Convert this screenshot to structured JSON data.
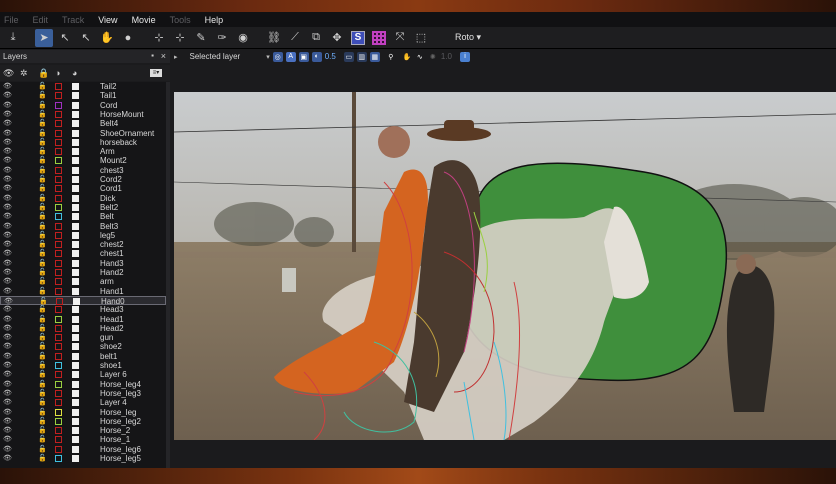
{
  "menu": [
    "File",
    "Edit",
    "Track",
    "View",
    "Movie",
    "Tools",
    "Help"
  ],
  "menu_dim": [
    true,
    true,
    true,
    false,
    false,
    true,
    false
  ],
  "toolbar": {
    "roto_label": "Roto",
    "s_label": "S"
  },
  "layers_panel": {
    "title": "Layers",
    "close": "×",
    "pin": "▪"
  },
  "viewer_toolbar": {
    "layer_select": "Selected layer",
    "opacity_value": "0.5",
    "disabled_value": "1.0"
  },
  "layers": [
    {
      "name": "Tail2",
      "color": "#c02020"
    },
    {
      "name": "Tail1",
      "color": "#c02020"
    },
    {
      "name": "Cord",
      "color": "#a030c0"
    },
    {
      "name": "HorseMount",
      "color": "#c02020"
    },
    {
      "name": "Belt4",
      "color": "#c02020"
    },
    {
      "name": "ShoeOrnament",
      "color": "#c02020"
    },
    {
      "name": "horseback",
      "color": "#c02020"
    },
    {
      "name": "Arm",
      "color": "#c02020"
    },
    {
      "name": "Mount2",
      "color": "#9ad040"
    },
    {
      "name": "chest3",
      "color": "#c02020"
    },
    {
      "name": "Cord2",
      "color": "#c02020"
    },
    {
      "name": "Cord1",
      "color": "#c02020"
    },
    {
      "name": "Dick",
      "color": "#c02020"
    },
    {
      "name": "Belt2",
      "color": "#9ad040"
    },
    {
      "name": "Belt",
      "color": "#40c0e0"
    },
    {
      "name": "Belt3",
      "color": "#c02020"
    },
    {
      "name": "leg5",
      "color": "#c02020"
    },
    {
      "name": "chest2",
      "color": "#c02020"
    },
    {
      "name": "chest1",
      "color": "#c02020"
    },
    {
      "name": "Hand3",
      "color": "#c02020"
    },
    {
      "name": "Hand2",
      "color": "#c02020"
    },
    {
      "name": "arm",
      "color": "#c02020"
    },
    {
      "name": "Hand1",
      "color": "#c02020"
    },
    {
      "name": "Hand0",
      "color": "#c02020",
      "selected": true
    },
    {
      "name": "Head3",
      "color": "#c02020"
    },
    {
      "name": "Head1",
      "color": "#9ad040"
    },
    {
      "name": "Head2",
      "color": "#c02020"
    },
    {
      "name": "gun",
      "color": "#c02020"
    },
    {
      "name": "shoe2",
      "color": "#c02020"
    },
    {
      "name": "belt1",
      "color": "#c02020"
    },
    {
      "name": "shoe1",
      "color": "#40c0e0"
    },
    {
      "name": "Layer 6",
      "color": "#c02020"
    },
    {
      "name": "Horse_leg4",
      "color": "#9ad040"
    },
    {
      "name": "Horse_leg3",
      "color": "#c02020"
    },
    {
      "name": "Layer 4",
      "color": "#c02020"
    },
    {
      "name": "Horse_leg",
      "color": "#e0e040"
    },
    {
      "name": "Horse_leg2",
      "color": "#9ad040"
    },
    {
      "name": "Horse_2",
      "color": "#c02020"
    },
    {
      "name": "Horse_1",
      "color": "#c02020"
    },
    {
      "name": "Horse_leg6",
      "color": "#c02020"
    },
    {
      "name": "Horse_leg5",
      "color": "#40c0e0"
    }
  ]
}
